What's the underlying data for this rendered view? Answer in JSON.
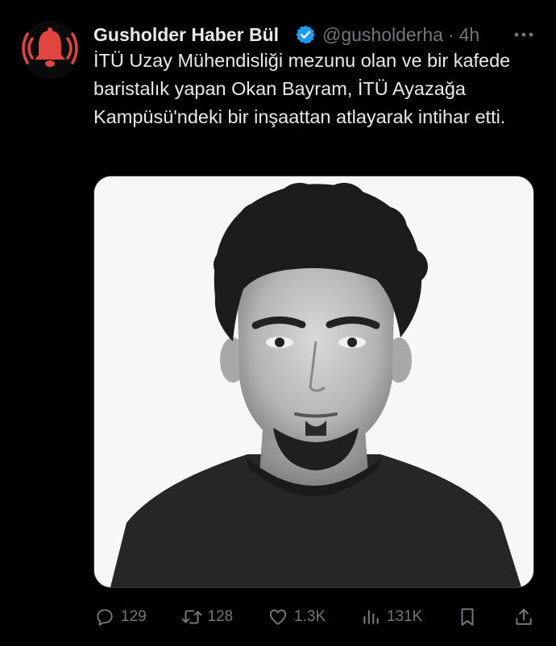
{
  "tweet": {
    "author": {
      "display_name": "Gusholder Haber Bül",
      "handle": "@gusholderha",
      "time": "4h",
      "avatar_icon": "red-bell-alarm-icon",
      "verified_icon": "verified-badge-icon",
      "verified_color": "#1d9bf0"
    },
    "separator": "·",
    "text": "İTÜ Uzay Mühendisliği mezunu olan ve bir kafede baristalık yapan Okan Bayram, İTÜ Ayazağa Kampüsü'ndeki bir inşaattan atlayarak intihar etti.",
    "media": {
      "type": "black-and-white portrait photo"
    },
    "actions": {
      "replies": "129",
      "reposts": "128",
      "likes": "1.3K",
      "views": "131K"
    },
    "colors": {
      "background": "#000000",
      "text": "#e7e9ea",
      "muted": "#71767b",
      "avatar_accent": "#e0453f"
    }
  }
}
